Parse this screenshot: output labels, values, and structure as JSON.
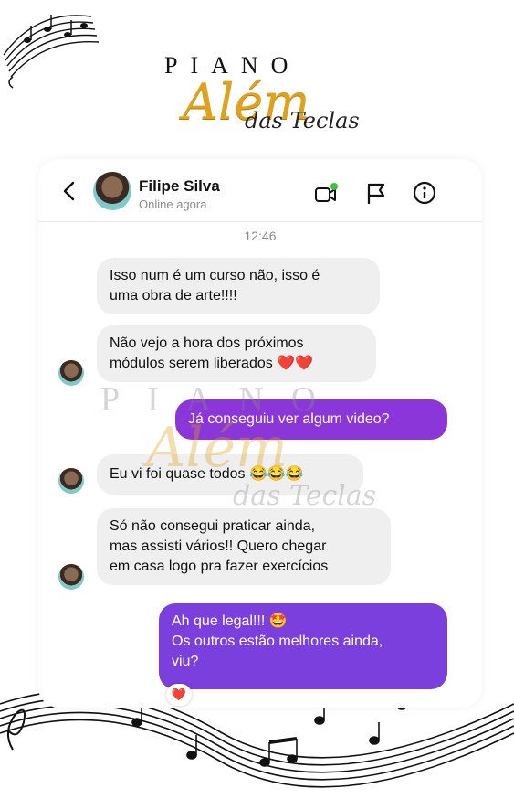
{
  "brand": {
    "word1": "PIANO",
    "word2": "Além",
    "word3": "das Teclas"
  },
  "watermark": {
    "word1": "PIANO",
    "word2": "Além",
    "word3": "das Teclas"
  },
  "chat": {
    "contact_name": "Filipe Silva",
    "contact_status": "Online agora",
    "timestamp": "12:46",
    "messages": [
      {
        "sender": "contact",
        "text_line1": "Isso num é um curso não, isso é",
        "text_line2": "uma obra de arte!!!!"
      },
      {
        "sender": "contact",
        "text_line1": "Não vejo a hora dos próximos",
        "text_line2": "módulos serem liberados ❤️❤️"
      },
      {
        "sender": "me",
        "text": "Já conseguiu ver algum video?"
      },
      {
        "sender": "contact",
        "text": "Eu vi foi quase todos 😂😂😂"
      },
      {
        "sender": "contact",
        "text_line1": "Só não consegui praticar ainda,",
        "text_line2": "mas assisti vários!! Quero chegar",
        "text_line3": "em casa logo pra fazer exercícios"
      },
      {
        "sender": "me",
        "text_line1": "Ah que legal!!! 🤩",
        "text_line2": "Os outros estão melhores ainda,",
        "text_line3": "viu?",
        "reaction": "❤️"
      }
    ]
  },
  "icons": {
    "back": "back-arrow-icon",
    "video": "video-call-icon",
    "flag": "flag-icon",
    "info": "info-icon"
  },
  "colors": {
    "incoming_bubble": "#efefef",
    "outgoing_bubble": "#8b36d9",
    "brand_gold": "#e0a21a",
    "online_dot": "#3ac43a"
  }
}
